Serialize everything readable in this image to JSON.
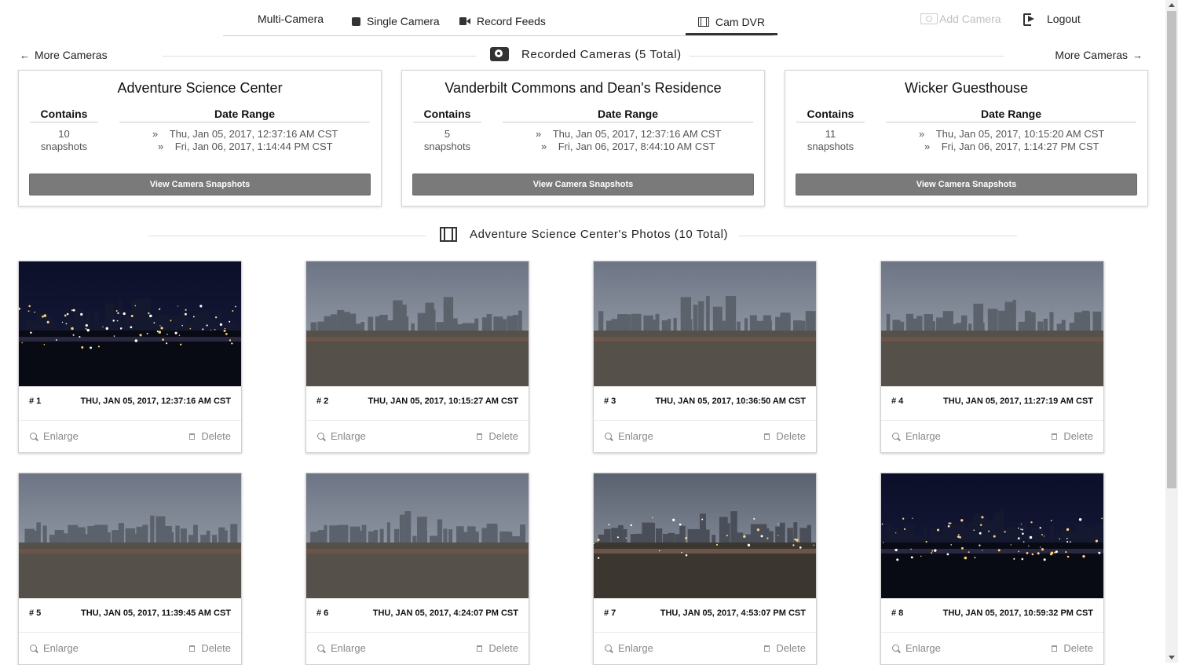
{
  "nav": {
    "multi_camera": "Multi-Camera",
    "single_camera": "Single Camera",
    "record_feeds": "Record Feeds",
    "cam_dvr": "Cam DVR",
    "add_camera": "Add Camera",
    "logout": "Logout"
  },
  "header": {
    "more_left": "More Cameras",
    "more_right": "More Cameras",
    "title": "Recorded Cameras (5 Total)"
  },
  "cameras": [
    {
      "name": "Adventure Science Center",
      "contains_label": "Contains",
      "range_label": "Date Range",
      "count": "10",
      "count_unit": "snapshots",
      "start": "Thu, Jan 05, 2017, 12:37:16 AM CST",
      "end": "Fri, Jan 06, 2017, 1:14:44 PM CST",
      "button": "View Camera Snapshots"
    },
    {
      "name": "Vanderbilt Commons and Dean's Residence",
      "contains_label": "Contains",
      "range_label": "Date Range",
      "count": "5",
      "count_unit": "snapshots",
      "start": "Thu, Jan 05, 2017, 12:37:16 AM CST",
      "end": "Fri, Jan 06, 2017, 8:44:10 AM CST",
      "button": "View Camera Snapshots"
    },
    {
      "name": "Wicker Guesthouse",
      "contains_label": "Contains",
      "range_label": "Date Range",
      "count": "11",
      "count_unit": "snapshots",
      "start": "Thu, Jan 05, 2017, 10:15:20 AM CST",
      "end": "Fri, Jan 06, 2017, 1:14:27 PM CST",
      "button": "View Camera Snapshots"
    }
  ],
  "photos_title": "Adventure Science Center's Photos (10 Total)",
  "photo_actions": {
    "enlarge": "Enlarge",
    "delete": "Delete"
  },
  "photos": [
    {
      "num": "# 1",
      "date": "THU, JAN 05, 2017, 12:37:16 AM CST",
      "scene": "night"
    },
    {
      "num": "# 2",
      "date": "THU, JAN 05, 2017, 10:15:27 AM CST",
      "scene": "day"
    },
    {
      "num": "# 3",
      "date": "THU, JAN 05, 2017, 10:36:50 AM CST",
      "scene": "day"
    },
    {
      "num": "# 4",
      "date": "THU, JAN 05, 2017, 11:27:19 AM CST",
      "scene": "day"
    },
    {
      "num": "# 5",
      "date": "THU, JAN 05, 2017, 11:39:45 AM CST",
      "scene": "day"
    },
    {
      "num": "# 6",
      "date": "THU, JAN 05, 2017, 4:24:07 PM CST",
      "scene": "day"
    },
    {
      "num": "# 7",
      "date": "THU, JAN 05, 2017, 4:53:07 PM CST",
      "scene": "dusk"
    },
    {
      "num": "# 8",
      "date": "THU, JAN 05, 2017, 10:59:32 PM CST",
      "scene": "night"
    }
  ]
}
